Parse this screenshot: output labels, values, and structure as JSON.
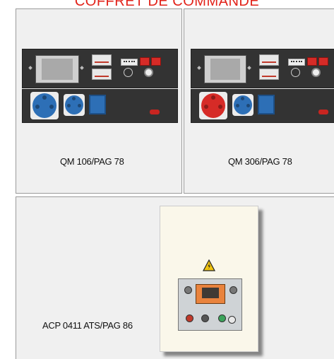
{
  "page": {
    "title": "COFFRET DE COMMANDE"
  },
  "products": [
    {
      "caption": "QM 106/PAG 78"
    },
    {
      "caption": "QM 306/PAG 78"
    },
    {
      "caption": "ACP 0411 ATS/PAG 86"
    }
  ],
  "icons": {
    "warning": "warning-triangle-icon",
    "socket": "power-socket-icon"
  },
  "colors": {
    "title": "#e2231a",
    "socket_blue": "#2d6fb6",
    "socket_red": "#d62b27",
    "panel": "#333333",
    "controller": "#e9833d"
  }
}
